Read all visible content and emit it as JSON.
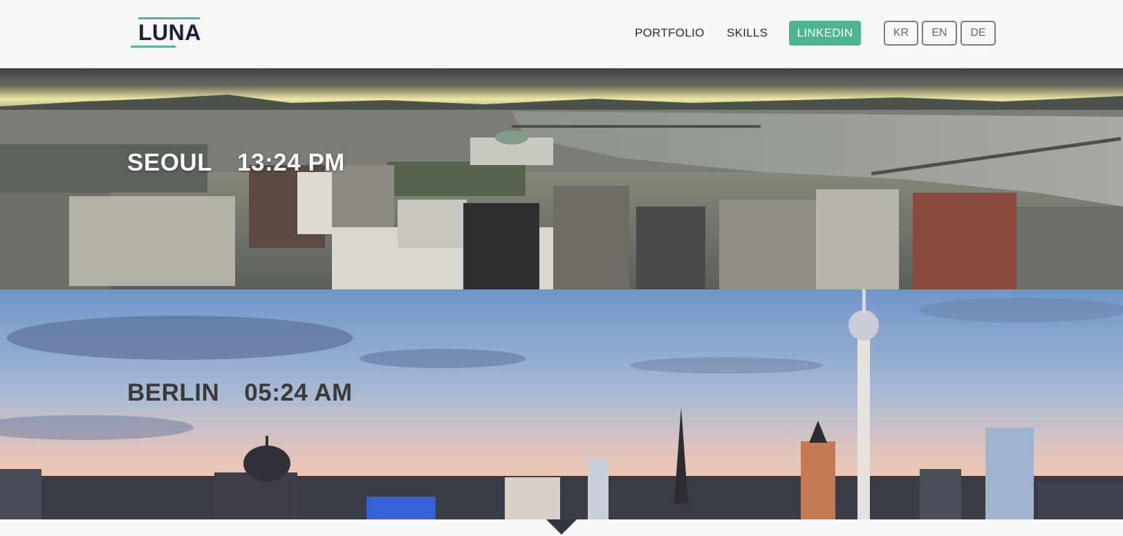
{
  "header": {
    "logo_text": "LUNA",
    "accent_color": "#4db592",
    "nav": {
      "portfolio": "PORTFOLIO",
      "skills": "SKILLS",
      "linkedin": "LINKEDIN"
    },
    "languages": [
      "KR",
      "EN",
      "DE"
    ]
  },
  "cities": [
    {
      "name": "SEOUL",
      "time": "13:24 PM"
    },
    {
      "name": "BERLIN",
      "time": "05:24 AM"
    }
  ],
  "icons": {
    "scroll": "chevron-down-icon"
  }
}
